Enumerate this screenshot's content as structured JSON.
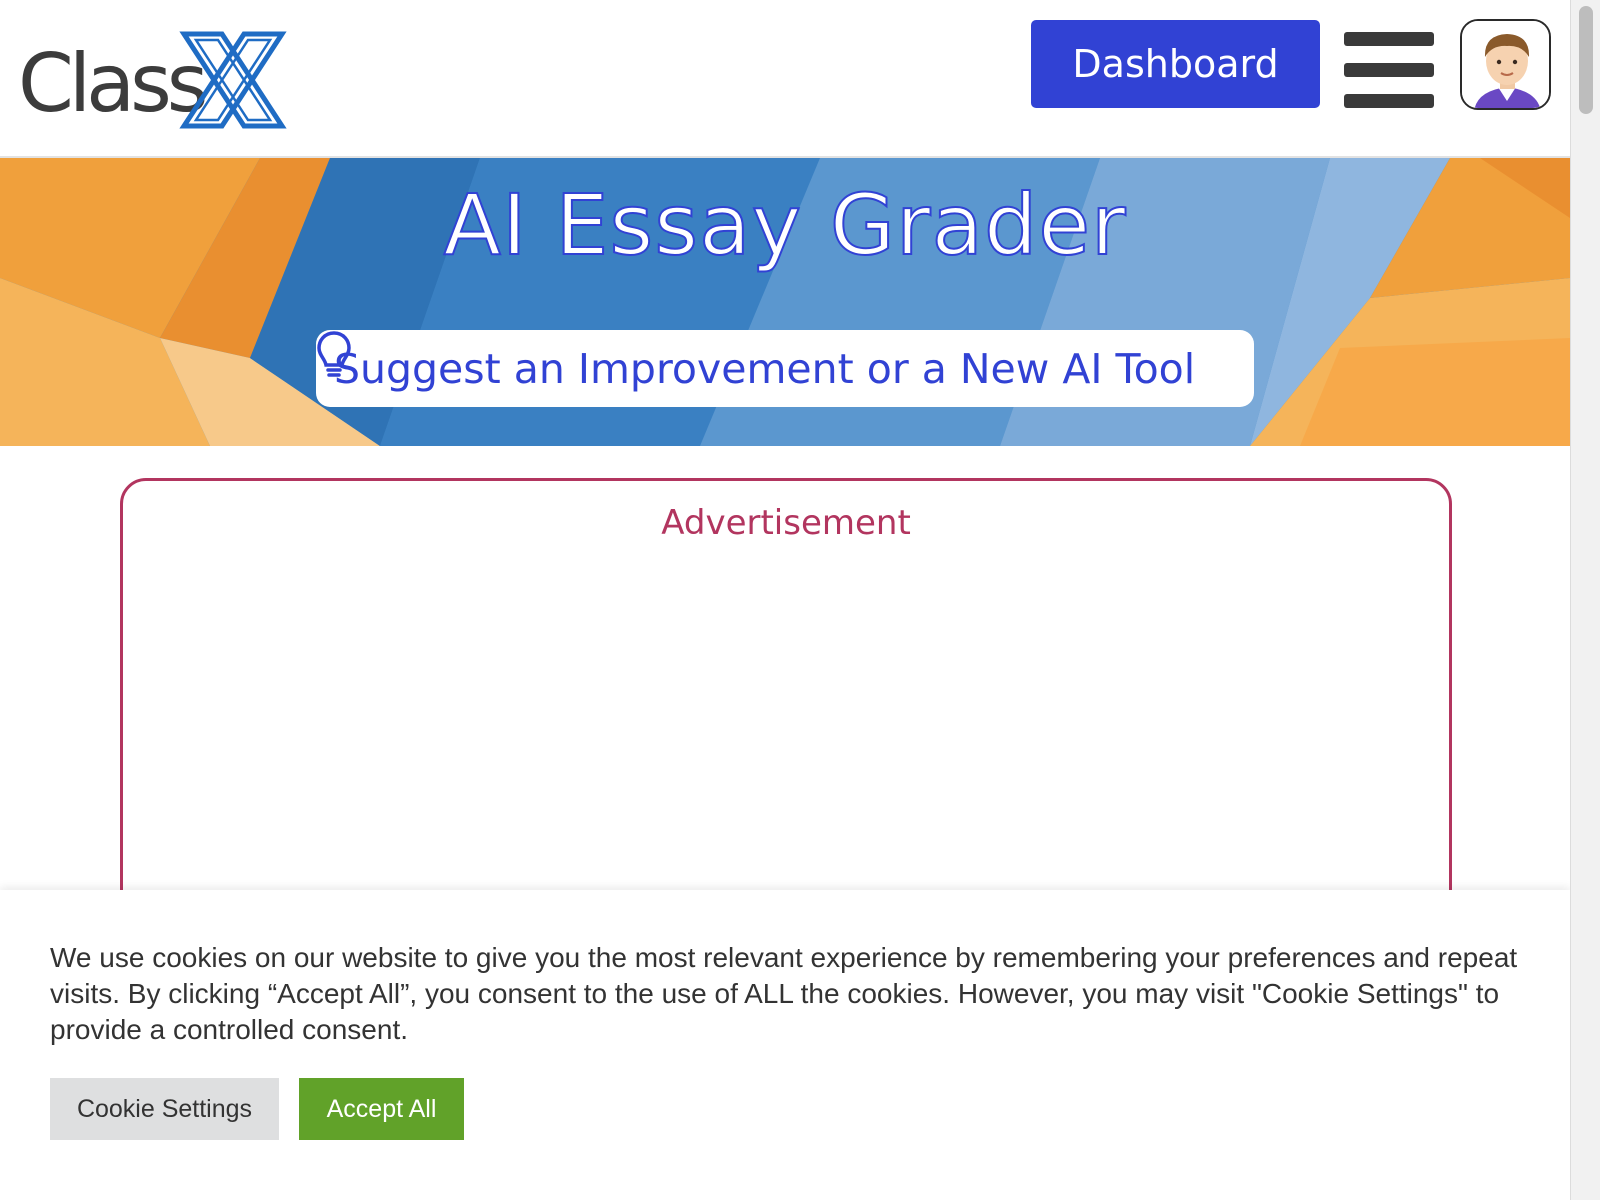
{
  "header": {
    "logo_text": "Class",
    "logo_mark": "X",
    "dashboard_label": "Dashboard",
    "menu_icon": "hamburger-menu-icon",
    "avatar_icon": "user-avatar-icon"
  },
  "banner": {
    "title": "AI Essay Grader",
    "suggest_label": "Suggest an Improvement or a New AI Tool",
    "suggest_icon": "lightbulb-icon"
  },
  "ad": {
    "label": "Advertisement"
  },
  "cookie": {
    "message": "We use cookies on our website to give you the most relevant experience by remembering your preferences and repeat visits. By clicking “Accept All”, you consent to the use of ALL the cookies. However, you may visit \"Cookie Settings\" to provide a controlled consent.",
    "settings_label": "Cookie Settings",
    "accept_label": "Accept All"
  },
  "colors": {
    "brand_blue": "#3142d4",
    "ad_border": "#b2355f",
    "accept_green": "#61a229",
    "banner_orange": "#f0a03c",
    "banner_blue": "#3f86c4"
  }
}
